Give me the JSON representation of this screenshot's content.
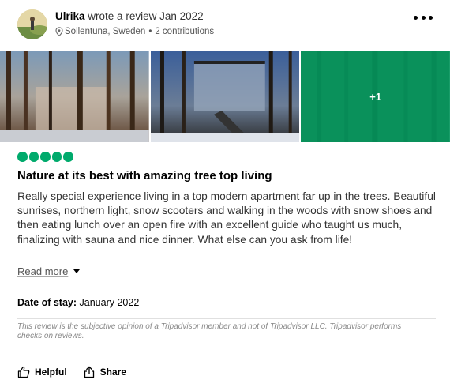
{
  "review": {
    "author": "Ulrika",
    "action_text": "wrote a review",
    "date": "Jan 2022",
    "location": "Sollentuna, Sweden",
    "separator": "•",
    "contributions": "2 contributions",
    "more_photos_label": "+1",
    "rating": 5,
    "title": "Nature at its best with amazing tree top living",
    "body": "Really special experience living in a top modern apartment far up in the trees. Beautiful sunrises, northern light, snow scooters and walking in the woods with snow shoes and then eating lunch over an open fire with an excellent guide who taught us much, finalizing with sauna and nice dinner. What else can you ask from life!",
    "read_more": "Read more",
    "date_of_stay_label": "Date of stay:",
    "date_of_stay_value": "January 2022",
    "disclaimer": "This review is the subjective opinion of a Tripadvisor member and not of Tripadvisor LLC. Tripadvisor performs checks on reviews."
  },
  "actions": {
    "helpful": "Helpful",
    "share": "Share"
  },
  "colors": {
    "bubble": "#00aa6c",
    "overlay": "#00a064"
  },
  "icons": [
    "map-pin-icon",
    "more-options-icon",
    "thumbs-up-icon",
    "share-icon",
    "caret-down-icon"
  ]
}
